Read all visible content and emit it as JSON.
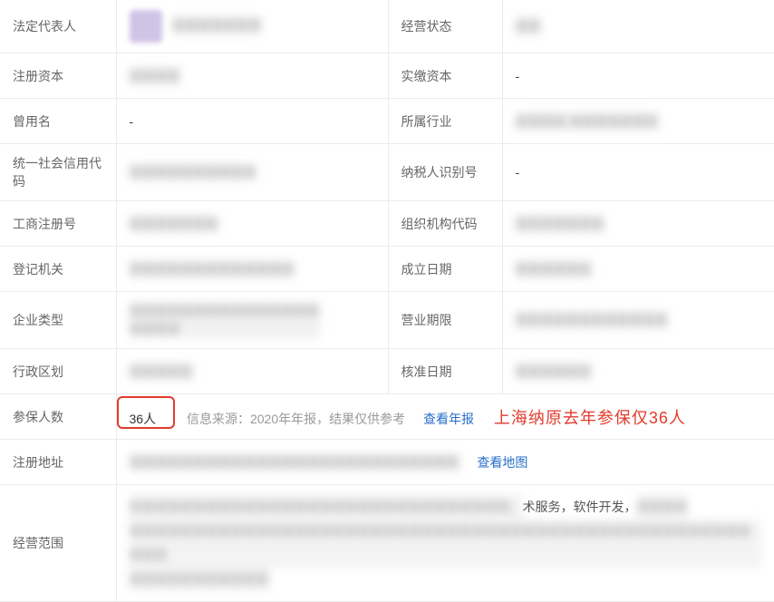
{
  "rows": {
    "legal_rep": {
      "label": "法定代表人"
    },
    "op_status": {
      "label": "经营状态"
    },
    "reg_capital": {
      "label": "注册资本"
    },
    "paid_capital": {
      "label": "实缴资本",
      "value": "-"
    },
    "former_name": {
      "label": "曾用名",
      "value": "-"
    },
    "industry": {
      "label": "所属行业"
    },
    "uscc": {
      "label": "统一社会信用代码"
    },
    "tax_id": {
      "label": "纳税人识别号",
      "value": "-"
    },
    "biz_reg_no": {
      "label": "工商注册号"
    },
    "org_code": {
      "label": "组织机构代码"
    },
    "reg_authority": {
      "label": "登记机关"
    },
    "est_date": {
      "label": "成立日期"
    },
    "ent_type": {
      "label": "企业类型"
    },
    "op_period": {
      "label": "营业期限"
    },
    "admin_div": {
      "label": "行政区划"
    },
    "approval_date": {
      "label": "核准日期"
    },
    "insured_count": {
      "label": "参保人数",
      "value": "36人",
      "source_note": "信息来源：2020年年报，结果仅供参考",
      "link_text": "查看年报",
      "annotation": "上海纳原去年参保仅36人"
    },
    "reg_address": {
      "label": "注册地址",
      "link_text": "查看地图"
    },
    "biz_scope": {
      "label": "经营范围",
      "visible_fragments": [
        "术服务，软件开发，"
      ]
    }
  }
}
